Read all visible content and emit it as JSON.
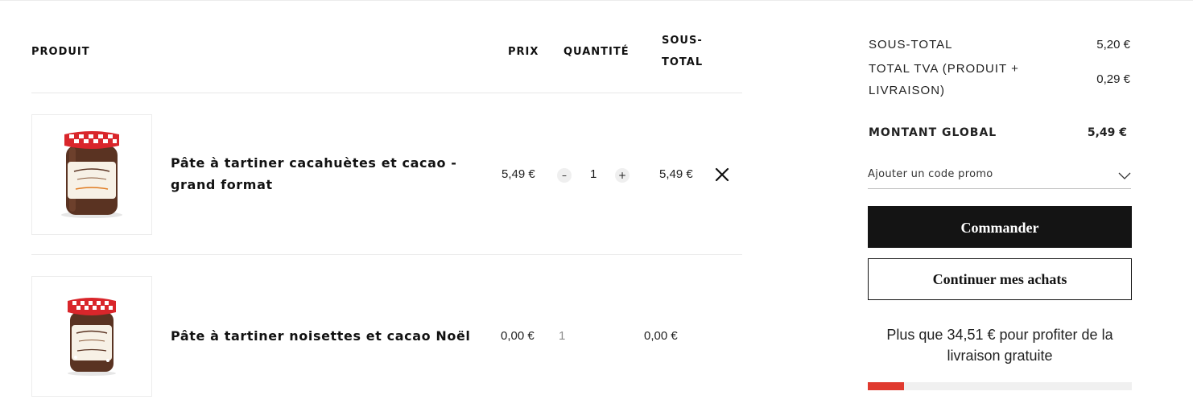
{
  "cart": {
    "headers": {
      "product": "PRODUIT",
      "price": "PRIX",
      "quantity": "QUANTITÉ",
      "subtotal": "SOUS-TOTAL"
    },
    "items": [
      {
        "name": "Pâte à tartiner cacahuètes et cacao - grand format",
        "price": "5,49 €",
        "quantity": "1",
        "subtotal": "5,49 €",
        "minus": "–",
        "plus": "+"
      },
      {
        "name": "Pâte à tartiner noisettes et cacao Noël",
        "price": "0,00 €",
        "quantity": "1",
        "subtotal": "0,00 €"
      }
    ]
  },
  "summary": {
    "subtotal_label": "SOUS-TOTAL",
    "subtotal_value": "5,20 €",
    "tva_label": "TOTAL TVA (PRODUIT + LIVRAISON)",
    "tva_value": "0,29 €",
    "total_label": "MONTANT GLOBAL",
    "total_value": "5,49 €",
    "promo_label": "Ajouter un code promo",
    "order_button": "Commander",
    "continue_button": "Continuer mes achats",
    "shipping_message": "Plus que 34,51 € pour profiter de la livraison gratuite",
    "shipping_progress": 0.137
  },
  "colors": {
    "accent": "#e03a2f",
    "button_dark": "#141414",
    "jar_lid_red": "#d9262b",
    "jar_chocolate": "#5a3322"
  },
  "icons": {
    "remove": "close-icon",
    "promo_toggle": "chevron-down-icon"
  }
}
